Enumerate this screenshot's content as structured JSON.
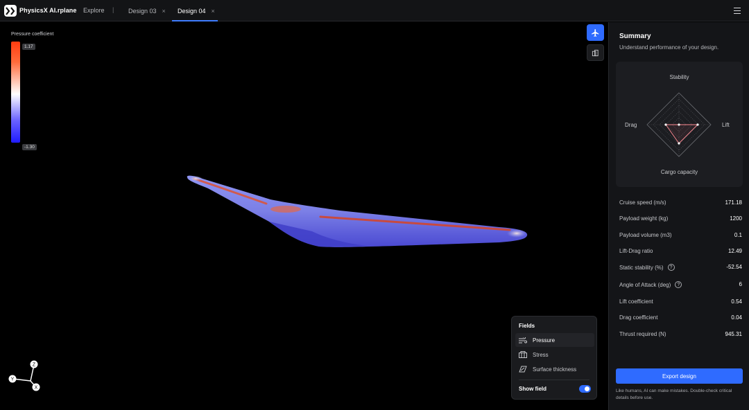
{
  "header": {
    "brand": "PhysicsX AI.rplane",
    "explore": "Explore",
    "separator": "|",
    "tabs": [
      {
        "label": "Design 03",
        "close": "×"
      },
      {
        "label": "Design 04",
        "close": "×"
      }
    ]
  },
  "legend": {
    "title": "Pressure coefficient",
    "max": "1.17",
    "min": "-1.30"
  },
  "axes": {
    "z": "Z",
    "y": "Y",
    "x": "X"
  },
  "fields": {
    "title": "Fields",
    "items": [
      {
        "label": "Pressure",
        "icon": "wind-icon",
        "active": true
      },
      {
        "label": "Stress",
        "icon": "layers-icon",
        "active": false
      },
      {
        "label": "Surface thickness",
        "icon": "surface-icon",
        "active": false
      }
    ],
    "show_field_label": "Show field",
    "show_field_on": true
  },
  "summary": {
    "title": "Summary",
    "subtitle": "Understand performance of your design.",
    "radar": {
      "top": "Stability",
      "right": "Lift",
      "bottom": "Cargo capacity",
      "left": "Drag"
    },
    "metrics": [
      {
        "label": "Cruise speed (m/s)",
        "value": "171.18"
      },
      {
        "label": "Payload weight (kg)",
        "value": "1200"
      },
      {
        "label": "Payload volume (m3)",
        "value": "0.1"
      },
      {
        "label": "Lift-Drag ratio",
        "value": "12.49"
      },
      {
        "label": "Static stability (%)",
        "value": "-52.54",
        "help": "?"
      },
      {
        "label": "Angle of Attack (deg)",
        "value": "6",
        "help": "?"
      },
      {
        "label": "Lift coefficient",
        "value": "0.54"
      },
      {
        "label": "Drag coefficient",
        "value": "0.04"
      },
      {
        "label": "Thrust required (N)",
        "value": "945.31"
      }
    ],
    "export_label": "Export design",
    "disclaimer": "Like humans, AI can make mistakes. Double-check critical details before use."
  },
  "colors": {
    "accent": "#2f6bff",
    "pressure_high": "#ff3d10",
    "pressure_low": "#1f1bff"
  }
}
